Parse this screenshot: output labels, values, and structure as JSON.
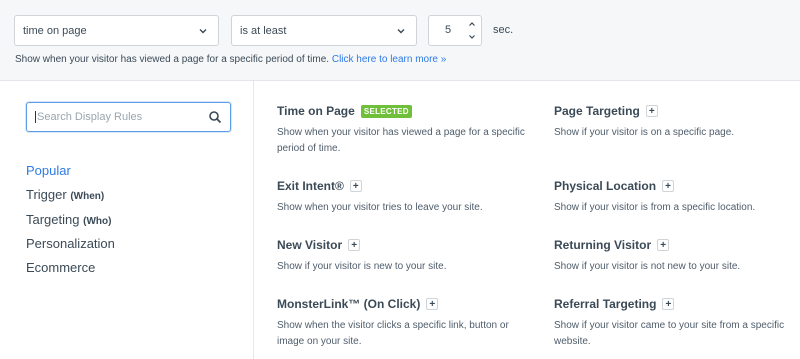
{
  "condition": {
    "trigger_select": "time on page",
    "operator_select": "is at least",
    "value": "5",
    "unit": "sec.",
    "hint_text": "Show when your visitor has viewed a page for a specific period of time.",
    "hint_link": "Click here to learn more »"
  },
  "search": {
    "placeholder": "Search Display Rules"
  },
  "nav": {
    "popular": "Popular",
    "trigger": "Trigger",
    "trigger_sub": "(When)",
    "targeting": "Targeting",
    "targeting_sub": "(Who)",
    "personalization": "Personalization",
    "ecommerce": "Ecommerce"
  },
  "rules": [
    {
      "title": "Time on Page",
      "badge": "SELECTED",
      "desc": "Show when your visitor has viewed a page for a specific period of time."
    },
    {
      "title": "Page Targeting",
      "desc": "Show if your visitor is on a specific page."
    },
    {
      "title": "Exit Intent®",
      "desc": "Show when your visitor tries to leave your site."
    },
    {
      "title": "Physical Location",
      "desc": "Show if your visitor is from a specific location."
    },
    {
      "title": "New Visitor",
      "desc": "Show if your visitor is new to your site."
    },
    {
      "title": "Returning Visitor",
      "desc": "Show if your visitor is not new to your site."
    },
    {
      "title": "MonsterLink™ (On Click)",
      "desc": "Show when the visitor clicks a specific link, button or image on your site."
    },
    {
      "title": "Referral Targeting",
      "desc": "Show if your visitor came to your site from a specific website."
    }
  ],
  "plus_label": "+",
  "colors": {
    "accent": "#2d7be5",
    "badge": "#6fbf3a"
  }
}
